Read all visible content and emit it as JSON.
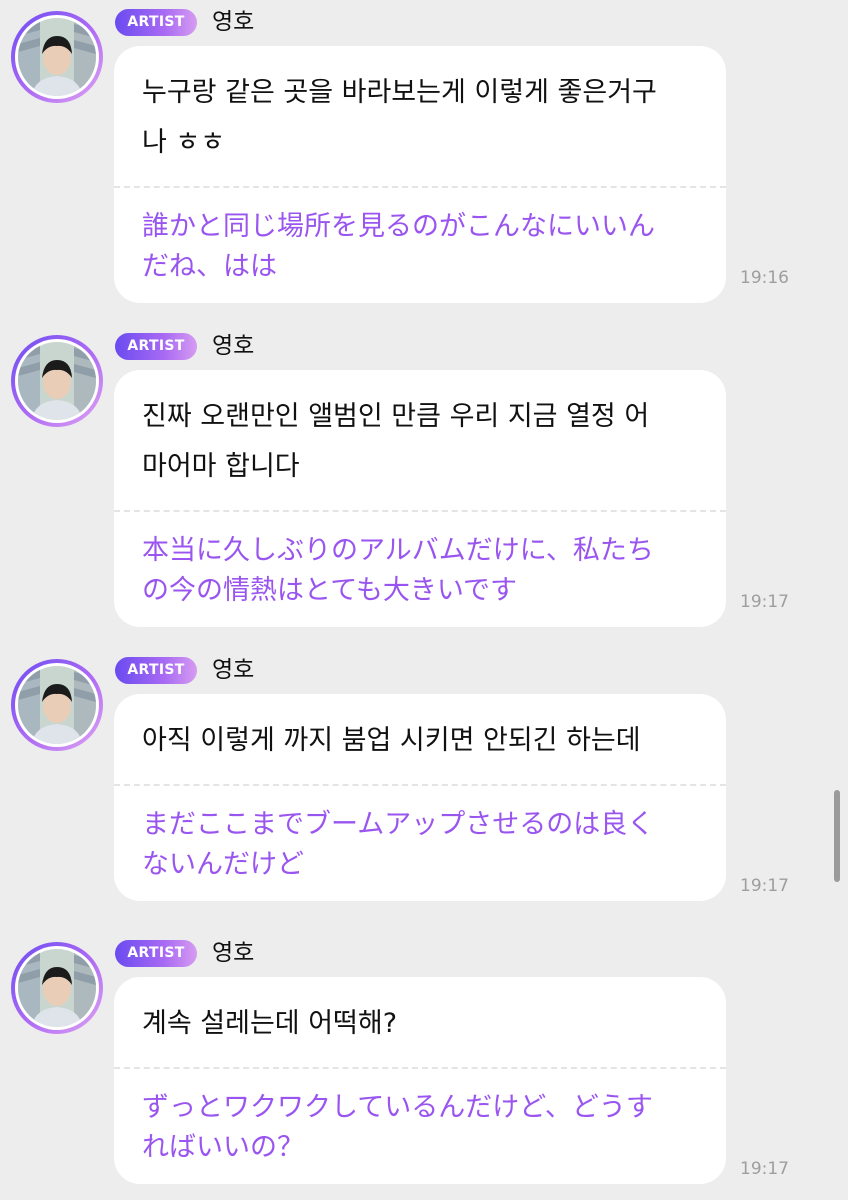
{
  "messages": [
    {
      "badge": "ARTIST",
      "sender": "영호",
      "original": "누구랑 같은 곳을 바라보는게 이렇게 좋은거구\n나 ㅎㅎ",
      "translation": "誰かと同じ場所を見るのがこんなにいいん\nだね、はは",
      "time": "19:16"
    },
    {
      "badge": "ARTIST",
      "sender": "영호",
      "original": "진짜 오랜만인 앨범인 만큼 우리 지금 열정 어\n마어마 합니다",
      "translation": "本当に久しぶりのアルバムだけに、私たち\nの今の情熱はとても大きいです",
      "time": "19:17"
    },
    {
      "badge": "ARTIST",
      "sender": "영호",
      "original": "아직 이렇게 까지 붐업 시키면 안되긴 하는데",
      "translation": "まだここまでブームアップさせるのは良く\nないんだけど",
      "time": "19:17"
    },
    {
      "badge": "ARTIST",
      "sender": "영호",
      "original": "계속 설레는데 어떡해?",
      "translation": "ずっとワクワクしているんだけど、どうす\nればいいの？",
      "time": "19:17"
    }
  ],
  "colors": {
    "background": "#ededed",
    "translation_text": "#9a55f0",
    "badge_gradient_start": "#6a4bf0",
    "badge_gradient_end": "#d69bf2"
  },
  "icons": {
    "avatar": "profile-photo"
  }
}
